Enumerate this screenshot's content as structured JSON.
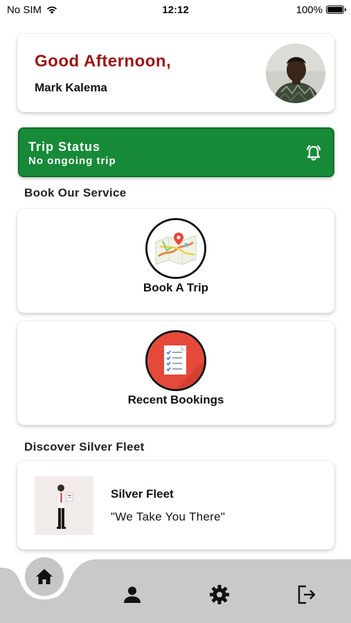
{
  "status_bar": {
    "carrier": "No SIM",
    "time": "12:12",
    "battery": "100%"
  },
  "header": {
    "greeting": "Good Afternoon,",
    "user_name": "Mark Kalema"
  },
  "trip_status": {
    "title": "Trip Status",
    "subtitle": "No ongoing trip"
  },
  "book_section": {
    "title": "Book Our Service",
    "services": [
      {
        "label": "Book A Trip",
        "icon": "map-icon"
      },
      {
        "label": "Recent Bookings",
        "icon": "checklist-icon"
      }
    ]
  },
  "discover_section": {
    "title": "Discover Silver Fleet",
    "card": {
      "title": "Silver Fleet",
      "tagline": "\"We Take You There\""
    }
  },
  "bottom_nav": {
    "items": [
      "home-icon",
      "person-icon",
      "gear-icon",
      "logout-icon"
    ]
  },
  "colors": {
    "greeting": "#9b1414",
    "trip_status_bg": "#178a37",
    "nav_bg": "#c9c9c9"
  }
}
